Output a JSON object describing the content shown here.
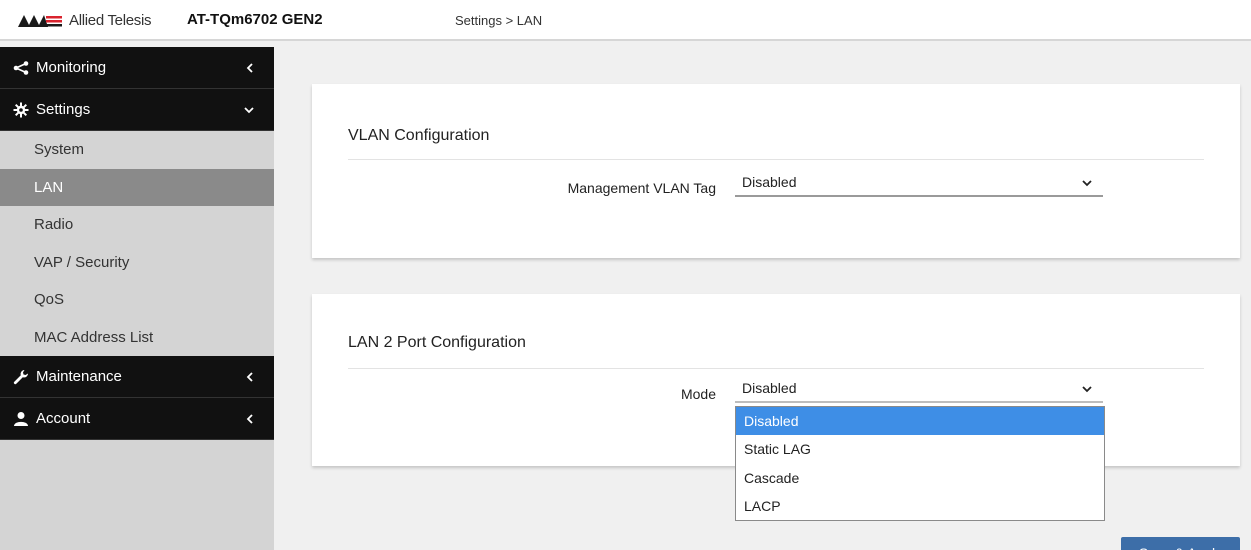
{
  "header": {
    "brand": "Allied Telesis",
    "product": "AT-TQm6702 GEN2",
    "breadcrumb": "Settings > LAN"
  },
  "sidebar": {
    "monitoring": {
      "label": "Monitoring",
      "icon": "share-icon"
    },
    "settings": {
      "label": "Settings",
      "icon": "gear-icon",
      "items": [
        {
          "label": "System"
        },
        {
          "label": "LAN",
          "active": true
        },
        {
          "label": "Radio"
        },
        {
          "label": "VAP / Security"
        },
        {
          "label": "QoS"
        },
        {
          "label": "MAC Address List"
        }
      ]
    },
    "maintenance": {
      "label": "Maintenance",
      "icon": "wrench-icon"
    },
    "account": {
      "label": "Account",
      "icon": "user-icon"
    }
  },
  "vlan": {
    "title": "VLAN Configuration",
    "field_label": "Management VLAN Tag",
    "value": "Disabled"
  },
  "lan2": {
    "title": "LAN 2 Port Configuration",
    "field_label": "Mode",
    "value": "Disabled",
    "options": [
      "Disabled",
      "Static LAG",
      "Cascade",
      "LACP"
    ]
  },
  "actions": {
    "save_label": "Save & Apply"
  },
  "colors": {
    "sidebar_bg": "#d4d4d4",
    "nav_group_bg": "#111111",
    "active_item_bg": "#8a8a8a",
    "highlight": "#3e8ee6",
    "button": "#3d6ea8",
    "logo_red": "#d9232e"
  }
}
